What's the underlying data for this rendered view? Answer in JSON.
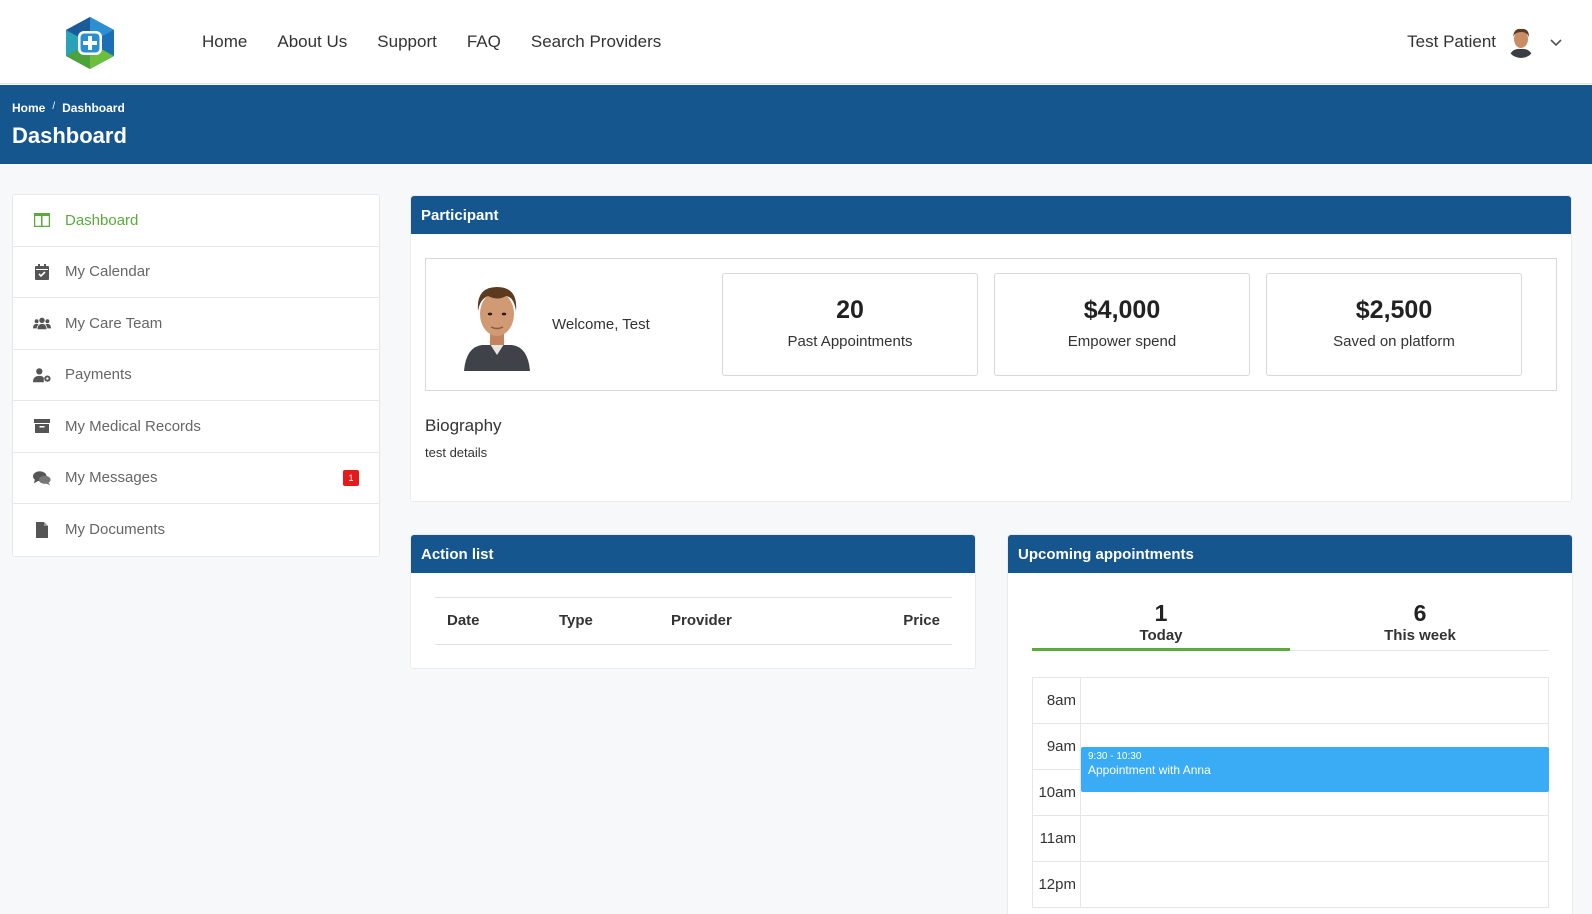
{
  "nav": {
    "links": [
      "Home",
      "About Us",
      "Support",
      "FAQ",
      "Search Providers"
    ],
    "user_name": "Test Patient"
  },
  "header": {
    "breadcrumb": [
      "Home",
      "Dashboard"
    ],
    "title": "Dashboard"
  },
  "sidebar": {
    "items": [
      {
        "label": "Dashboard",
        "icon": "dashboard-icon",
        "active": true
      },
      {
        "label": "My Calendar",
        "icon": "calendar-check-icon"
      },
      {
        "label": "My Care Team",
        "icon": "users-icon"
      },
      {
        "label": "Payments",
        "icon": "user-cog-icon"
      },
      {
        "label": "My Medical Records",
        "icon": "archive-icon"
      },
      {
        "label": "My Messages",
        "icon": "comments-icon",
        "badge": "1"
      },
      {
        "label": "My Documents",
        "icon": "file-icon"
      }
    ]
  },
  "participant": {
    "heading": "Participant",
    "welcome": "Welcome, Test",
    "stats": [
      {
        "value": "20",
        "caption": "Past Appointments"
      },
      {
        "value": "$4,000",
        "caption": "Empower spend"
      },
      {
        "value": "$2,500",
        "caption": "Saved on platform"
      }
    ],
    "bio_title": "Biography",
    "bio_text": "test details"
  },
  "action_list": {
    "heading": "Action list",
    "columns": [
      "Date",
      "Type",
      "Provider",
      "Price"
    ]
  },
  "upcoming": {
    "heading": "Upcoming appointments",
    "tabs": [
      {
        "count": "1",
        "label": "Today",
        "active": true
      },
      {
        "count": "6",
        "label": "This week"
      }
    ],
    "times": [
      "8am",
      "9am",
      "10am",
      "11am",
      "12pm"
    ],
    "event": {
      "time": "9:30 - 10:30",
      "title": "Appointment with Anna"
    }
  },
  "colors": {
    "brand_blue": "#15568f",
    "accent_green": "#5aab3c",
    "event_blue": "#3aabf5",
    "badge_red": "#e31b1b"
  }
}
